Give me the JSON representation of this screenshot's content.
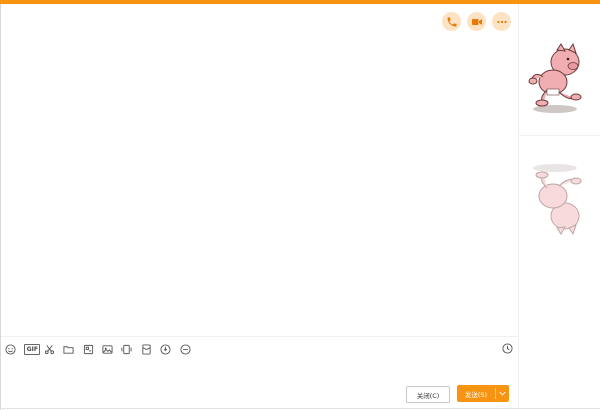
{
  "header": {
    "icons": [
      "phone-icon",
      "video-call-icon",
      "more-icon"
    ],
    "accent_color": "#f79412",
    "icon_bg_color": "#fde3c4"
  },
  "toolbar": {
    "tools": [
      "emoji-icon",
      "gif-icon",
      "scissors-icon",
      "folder-icon",
      "image-file-icon",
      "picture-icon",
      "phone-shake-icon",
      "red-packet-icon",
      "voice-icon",
      "screen-record-icon",
      "history-icon"
    ],
    "gif_label": "GIF"
  },
  "footer": {
    "close_label": "关闭(C)",
    "send_label": "发送(S)"
  },
  "sidebar": {
    "characters": [
      "running-pig-figure",
      "pig-reflection-figure"
    ]
  }
}
